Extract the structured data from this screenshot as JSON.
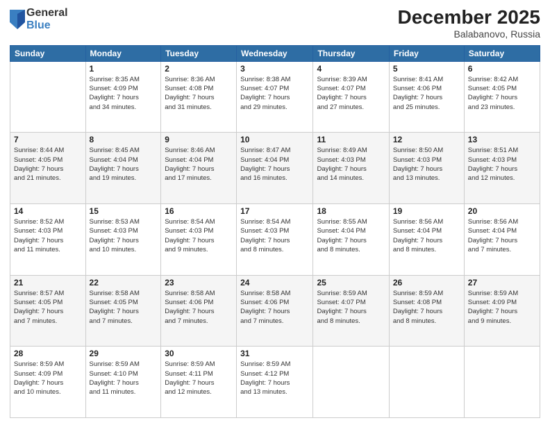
{
  "logo": {
    "general": "General",
    "blue": "Blue"
  },
  "title": "December 2025",
  "location": "Balabanovo, Russia",
  "headers": [
    "Sunday",
    "Monday",
    "Tuesday",
    "Wednesday",
    "Thursday",
    "Friday",
    "Saturday"
  ],
  "weeks": [
    [
      {
        "day": "",
        "info": ""
      },
      {
        "day": "1",
        "info": "Sunrise: 8:35 AM\nSunset: 4:09 PM\nDaylight: 7 hours\nand 34 minutes."
      },
      {
        "day": "2",
        "info": "Sunrise: 8:36 AM\nSunset: 4:08 PM\nDaylight: 7 hours\nand 31 minutes."
      },
      {
        "day": "3",
        "info": "Sunrise: 8:38 AM\nSunset: 4:07 PM\nDaylight: 7 hours\nand 29 minutes."
      },
      {
        "day": "4",
        "info": "Sunrise: 8:39 AM\nSunset: 4:07 PM\nDaylight: 7 hours\nand 27 minutes."
      },
      {
        "day": "5",
        "info": "Sunrise: 8:41 AM\nSunset: 4:06 PM\nDaylight: 7 hours\nand 25 minutes."
      },
      {
        "day": "6",
        "info": "Sunrise: 8:42 AM\nSunset: 4:05 PM\nDaylight: 7 hours\nand 23 minutes."
      }
    ],
    [
      {
        "day": "7",
        "info": "Sunrise: 8:44 AM\nSunset: 4:05 PM\nDaylight: 7 hours\nand 21 minutes."
      },
      {
        "day": "8",
        "info": "Sunrise: 8:45 AM\nSunset: 4:04 PM\nDaylight: 7 hours\nand 19 minutes."
      },
      {
        "day": "9",
        "info": "Sunrise: 8:46 AM\nSunset: 4:04 PM\nDaylight: 7 hours\nand 17 minutes."
      },
      {
        "day": "10",
        "info": "Sunrise: 8:47 AM\nSunset: 4:04 PM\nDaylight: 7 hours\nand 16 minutes."
      },
      {
        "day": "11",
        "info": "Sunrise: 8:49 AM\nSunset: 4:03 PM\nDaylight: 7 hours\nand 14 minutes."
      },
      {
        "day": "12",
        "info": "Sunrise: 8:50 AM\nSunset: 4:03 PM\nDaylight: 7 hours\nand 13 minutes."
      },
      {
        "day": "13",
        "info": "Sunrise: 8:51 AM\nSunset: 4:03 PM\nDaylight: 7 hours\nand 12 minutes."
      }
    ],
    [
      {
        "day": "14",
        "info": "Sunrise: 8:52 AM\nSunset: 4:03 PM\nDaylight: 7 hours\nand 11 minutes."
      },
      {
        "day": "15",
        "info": "Sunrise: 8:53 AM\nSunset: 4:03 PM\nDaylight: 7 hours\nand 10 minutes."
      },
      {
        "day": "16",
        "info": "Sunrise: 8:54 AM\nSunset: 4:03 PM\nDaylight: 7 hours\nand 9 minutes."
      },
      {
        "day": "17",
        "info": "Sunrise: 8:54 AM\nSunset: 4:03 PM\nDaylight: 7 hours\nand 8 minutes."
      },
      {
        "day": "18",
        "info": "Sunrise: 8:55 AM\nSunset: 4:04 PM\nDaylight: 7 hours\nand 8 minutes."
      },
      {
        "day": "19",
        "info": "Sunrise: 8:56 AM\nSunset: 4:04 PM\nDaylight: 7 hours\nand 8 minutes."
      },
      {
        "day": "20",
        "info": "Sunrise: 8:56 AM\nSunset: 4:04 PM\nDaylight: 7 hours\nand 7 minutes."
      }
    ],
    [
      {
        "day": "21",
        "info": "Sunrise: 8:57 AM\nSunset: 4:05 PM\nDaylight: 7 hours\nand 7 minutes."
      },
      {
        "day": "22",
        "info": "Sunrise: 8:58 AM\nSunset: 4:05 PM\nDaylight: 7 hours\nand 7 minutes."
      },
      {
        "day": "23",
        "info": "Sunrise: 8:58 AM\nSunset: 4:06 PM\nDaylight: 7 hours\nand 7 minutes."
      },
      {
        "day": "24",
        "info": "Sunrise: 8:58 AM\nSunset: 4:06 PM\nDaylight: 7 hours\nand 7 minutes."
      },
      {
        "day": "25",
        "info": "Sunrise: 8:59 AM\nSunset: 4:07 PM\nDaylight: 7 hours\nand 8 minutes."
      },
      {
        "day": "26",
        "info": "Sunrise: 8:59 AM\nSunset: 4:08 PM\nDaylight: 7 hours\nand 8 minutes."
      },
      {
        "day": "27",
        "info": "Sunrise: 8:59 AM\nSunset: 4:09 PM\nDaylight: 7 hours\nand 9 minutes."
      }
    ],
    [
      {
        "day": "28",
        "info": "Sunrise: 8:59 AM\nSunset: 4:09 PM\nDaylight: 7 hours\nand 10 minutes."
      },
      {
        "day": "29",
        "info": "Sunrise: 8:59 AM\nSunset: 4:10 PM\nDaylight: 7 hours\nand 11 minutes."
      },
      {
        "day": "30",
        "info": "Sunrise: 8:59 AM\nSunset: 4:11 PM\nDaylight: 7 hours\nand 12 minutes."
      },
      {
        "day": "31",
        "info": "Sunrise: 8:59 AM\nSunset: 4:12 PM\nDaylight: 7 hours\nand 13 minutes."
      },
      {
        "day": "",
        "info": ""
      },
      {
        "day": "",
        "info": ""
      },
      {
        "day": "",
        "info": ""
      }
    ]
  ]
}
